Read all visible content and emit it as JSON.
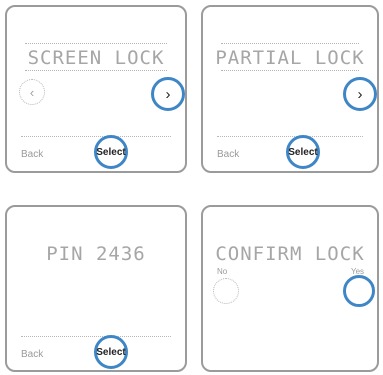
{
  "panels": [
    {
      "display_text": "SCREEN LOCK",
      "back_label": "Back",
      "select_label": "Select",
      "left_arrow": "‹",
      "right_arrow": "›"
    },
    {
      "display_text": "PARTIAL LOCK",
      "back_label": "Back",
      "select_label": "Select",
      "right_arrow": "›"
    },
    {
      "display_text": "PIN 2436",
      "back_label": "Back",
      "select_label": "Select"
    },
    {
      "display_text": "CONFIRM LOCK",
      "no_label": "No",
      "yes_label": "Yes"
    }
  ],
  "colors": {
    "highlight": "#3f86c6",
    "lcd_text": "#a6a6a6",
    "border": "#9b9b9b"
  },
  "icons": {
    "left": "chevron-left-icon",
    "right": "chevron-right-icon"
  }
}
